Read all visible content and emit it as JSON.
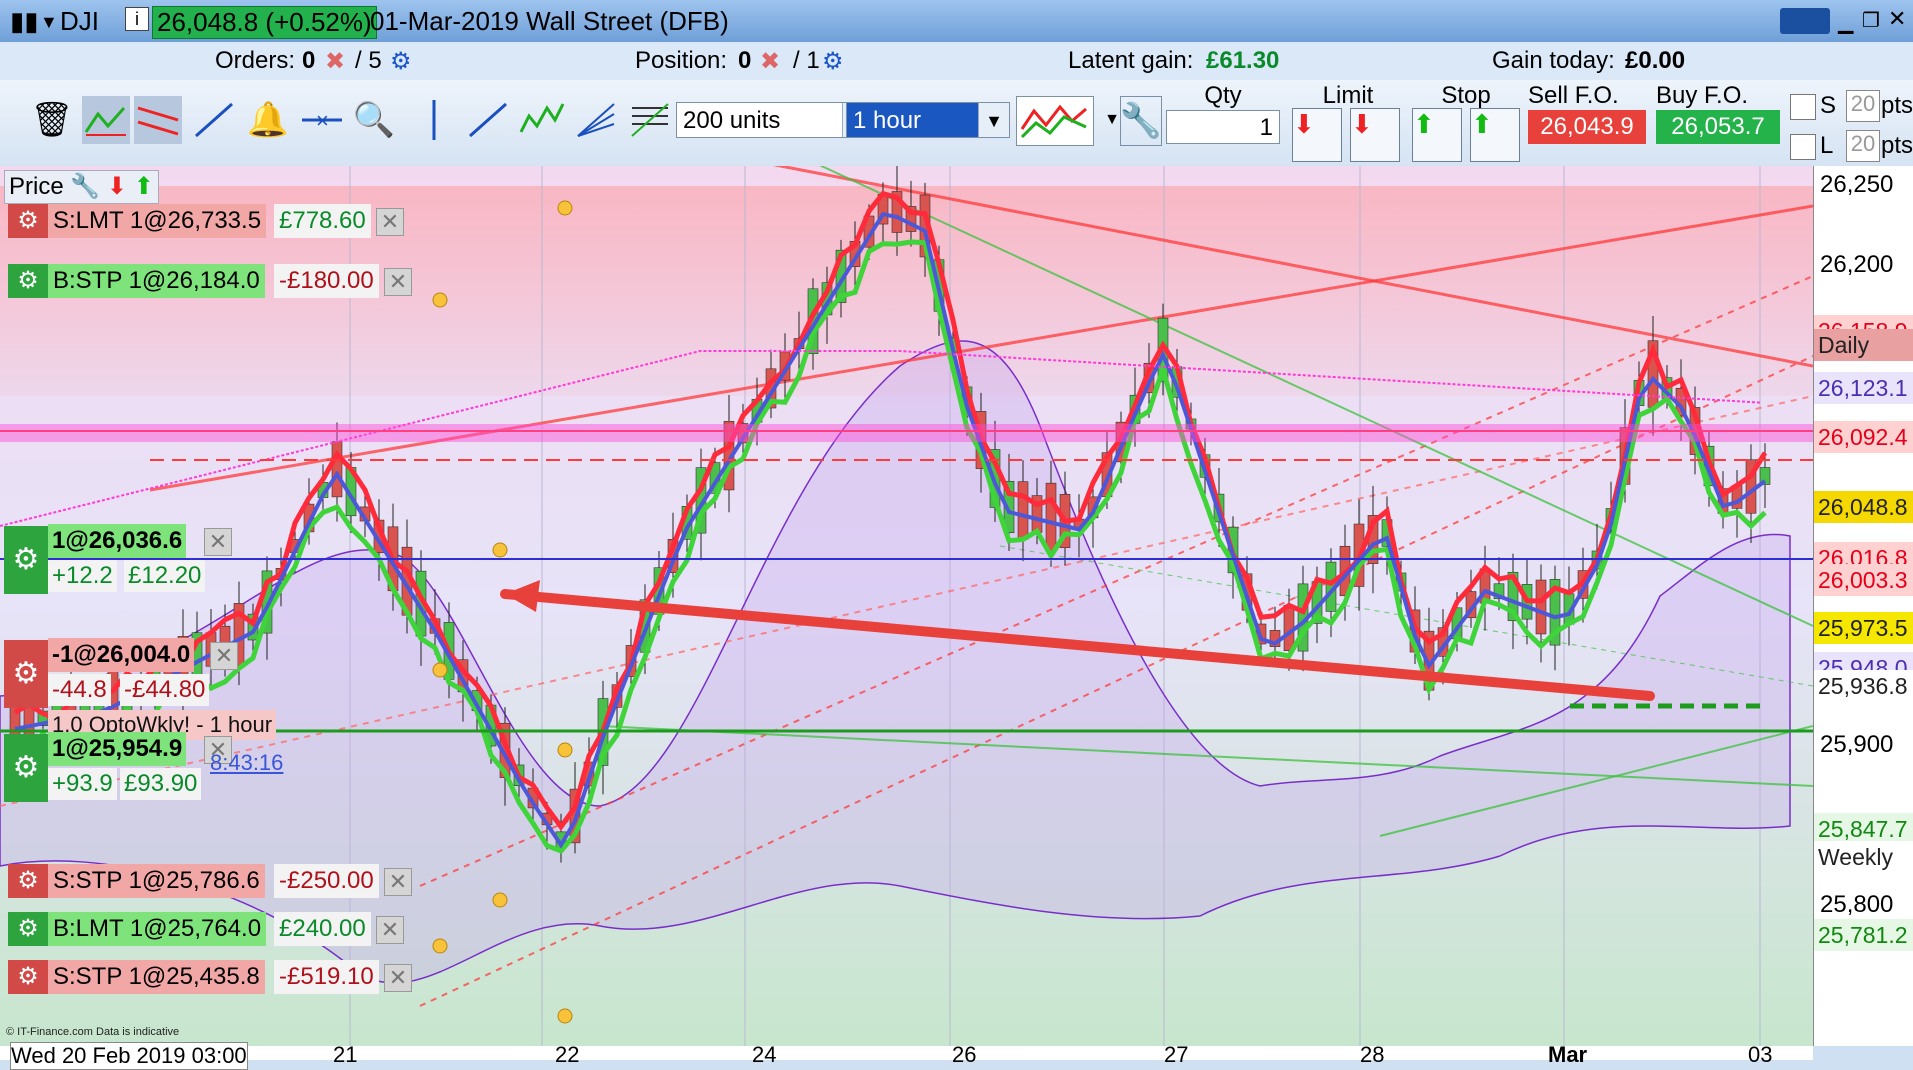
{
  "window": {
    "symbol": "DJI",
    "price_change": "26,048.8 (+0.52%)",
    "title": "01-Mar-2019 Wall Street (DFB)"
  },
  "infobar": {
    "orders_label": "Orders:",
    "orders_value": "0",
    "orders_total": "/ 5",
    "position_label": "Position:",
    "position_value": "0",
    "position_total": "/ 1",
    "latent_label": "Latent gain:",
    "latent_value": "£61.30",
    "gain_label": "Gain today:",
    "gain_value": "£0.00"
  },
  "toolbar": {
    "units_select": "200 units",
    "timeframe_select": "1 hour",
    "qty_label": "Qty",
    "qty_value": "1",
    "limit_label": "Limit",
    "stop_label": "Stop",
    "sell_label": "Sell F.O.",
    "buy_label": "Buy F.O.",
    "sell_price": "26,043.9",
    "buy_price": "26,053.7",
    "s_label": "S",
    "l_label": "L",
    "s_pts": "20",
    "l_pts": "20",
    "pts_label": "pts"
  },
  "chart": {
    "price_label": "Price",
    "y_ticks": [
      {
        "label": "26,250",
        "value": 26250
      },
      {
        "label": "26,200",
        "value": 26200
      },
      {
        "label": "25,900",
        "value": 25900
      },
      {
        "label": "25,800",
        "value": 25800
      }
    ],
    "x_labels": [
      "Wed 20 Feb 2019 03:00",
      "21",
      "22",
      "24",
      "26",
      "27",
      "28",
      "Mar",
      "03"
    ],
    "price_tags": [
      {
        "label": "26,158.9",
        "value": 26158.9,
        "color": "#ff3a3a"
      },
      {
        "label": "Daily",
        "value": 26150,
        "color": "#e8a0a0"
      },
      {
        "label": "26,123.1",
        "value": 26123.1,
        "color": "#5b3ec0"
      },
      {
        "label": "26,092.4",
        "value": 26092.4,
        "color": "#ff3a3a"
      },
      {
        "label": "26,048.8",
        "value": 26048.8,
        "color": "#f5d800"
      },
      {
        "label": "26,016.8",
        "value": 26016.8,
        "color": "#ff3a3a"
      },
      {
        "label": "26,003.3",
        "value": 26003.3,
        "color": "#ff3a3a"
      },
      {
        "label": "25,973.5",
        "value": 25973.5,
        "color": "#f5e700"
      },
      {
        "label": "25,948.0",
        "value": 25948.0,
        "color": "#5b3ec0"
      },
      {
        "label": "25,936.8",
        "value": 25936.8,
        "color": "#ffffff"
      },
      {
        "label": "25,847.7",
        "value": 25847.7,
        "color": "#22aa22"
      },
      {
        "label": "Weekly",
        "value": 25830,
        "color": "#ffffff"
      },
      {
        "label": "25,781.2",
        "value": 25781.2,
        "color": "#22aa22"
      }
    ],
    "orders": [
      {
        "label": "S:LMT 1@26,733.5",
        "pnl": "£778.60",
        "type": "sell"
      },
      {
        "label": "B:STP 1@26,184.0",
        "pnl": "-£180.00",
        "type": "buy"
      },
      {
        "label": "S:STP 1@25,786.6",
        "pnl": "-£250.00",
        "type": "sell"
      },
      {
        "label": "B:LMT 1@25,764.0",
        "pnl": "£240.00",
        "type": "buy"
      },
      {
        "label": "S:STP 1@25,435.8",
        "pnl": "-£519.10",
        "type": "sell"
      }
    ],
    "positions": [
      {
        "label": "1@26,036.6",
        "pnl_pts": "+12.2",
        "pnl": "£12.20",
        "type": "buy"
      },
      {
        "label": "-1@26,004.0",
        "pnl_pts": "-44.8",
        "pnl": "-£44.80",
        "type": "sell"
      },
      {
        "label": "1@25,954.9",
        "pnl_pts": "+93.9",
        "pnl": "£93.90",
        "type": "buy"
      }
    ],
    "alert_label": "1.0 OptoWkly! - 1 hour",
    "alert_time": "8:43:16",
    "footer_note": "© IT-Finance.com  Data is indicative"
  }
}
